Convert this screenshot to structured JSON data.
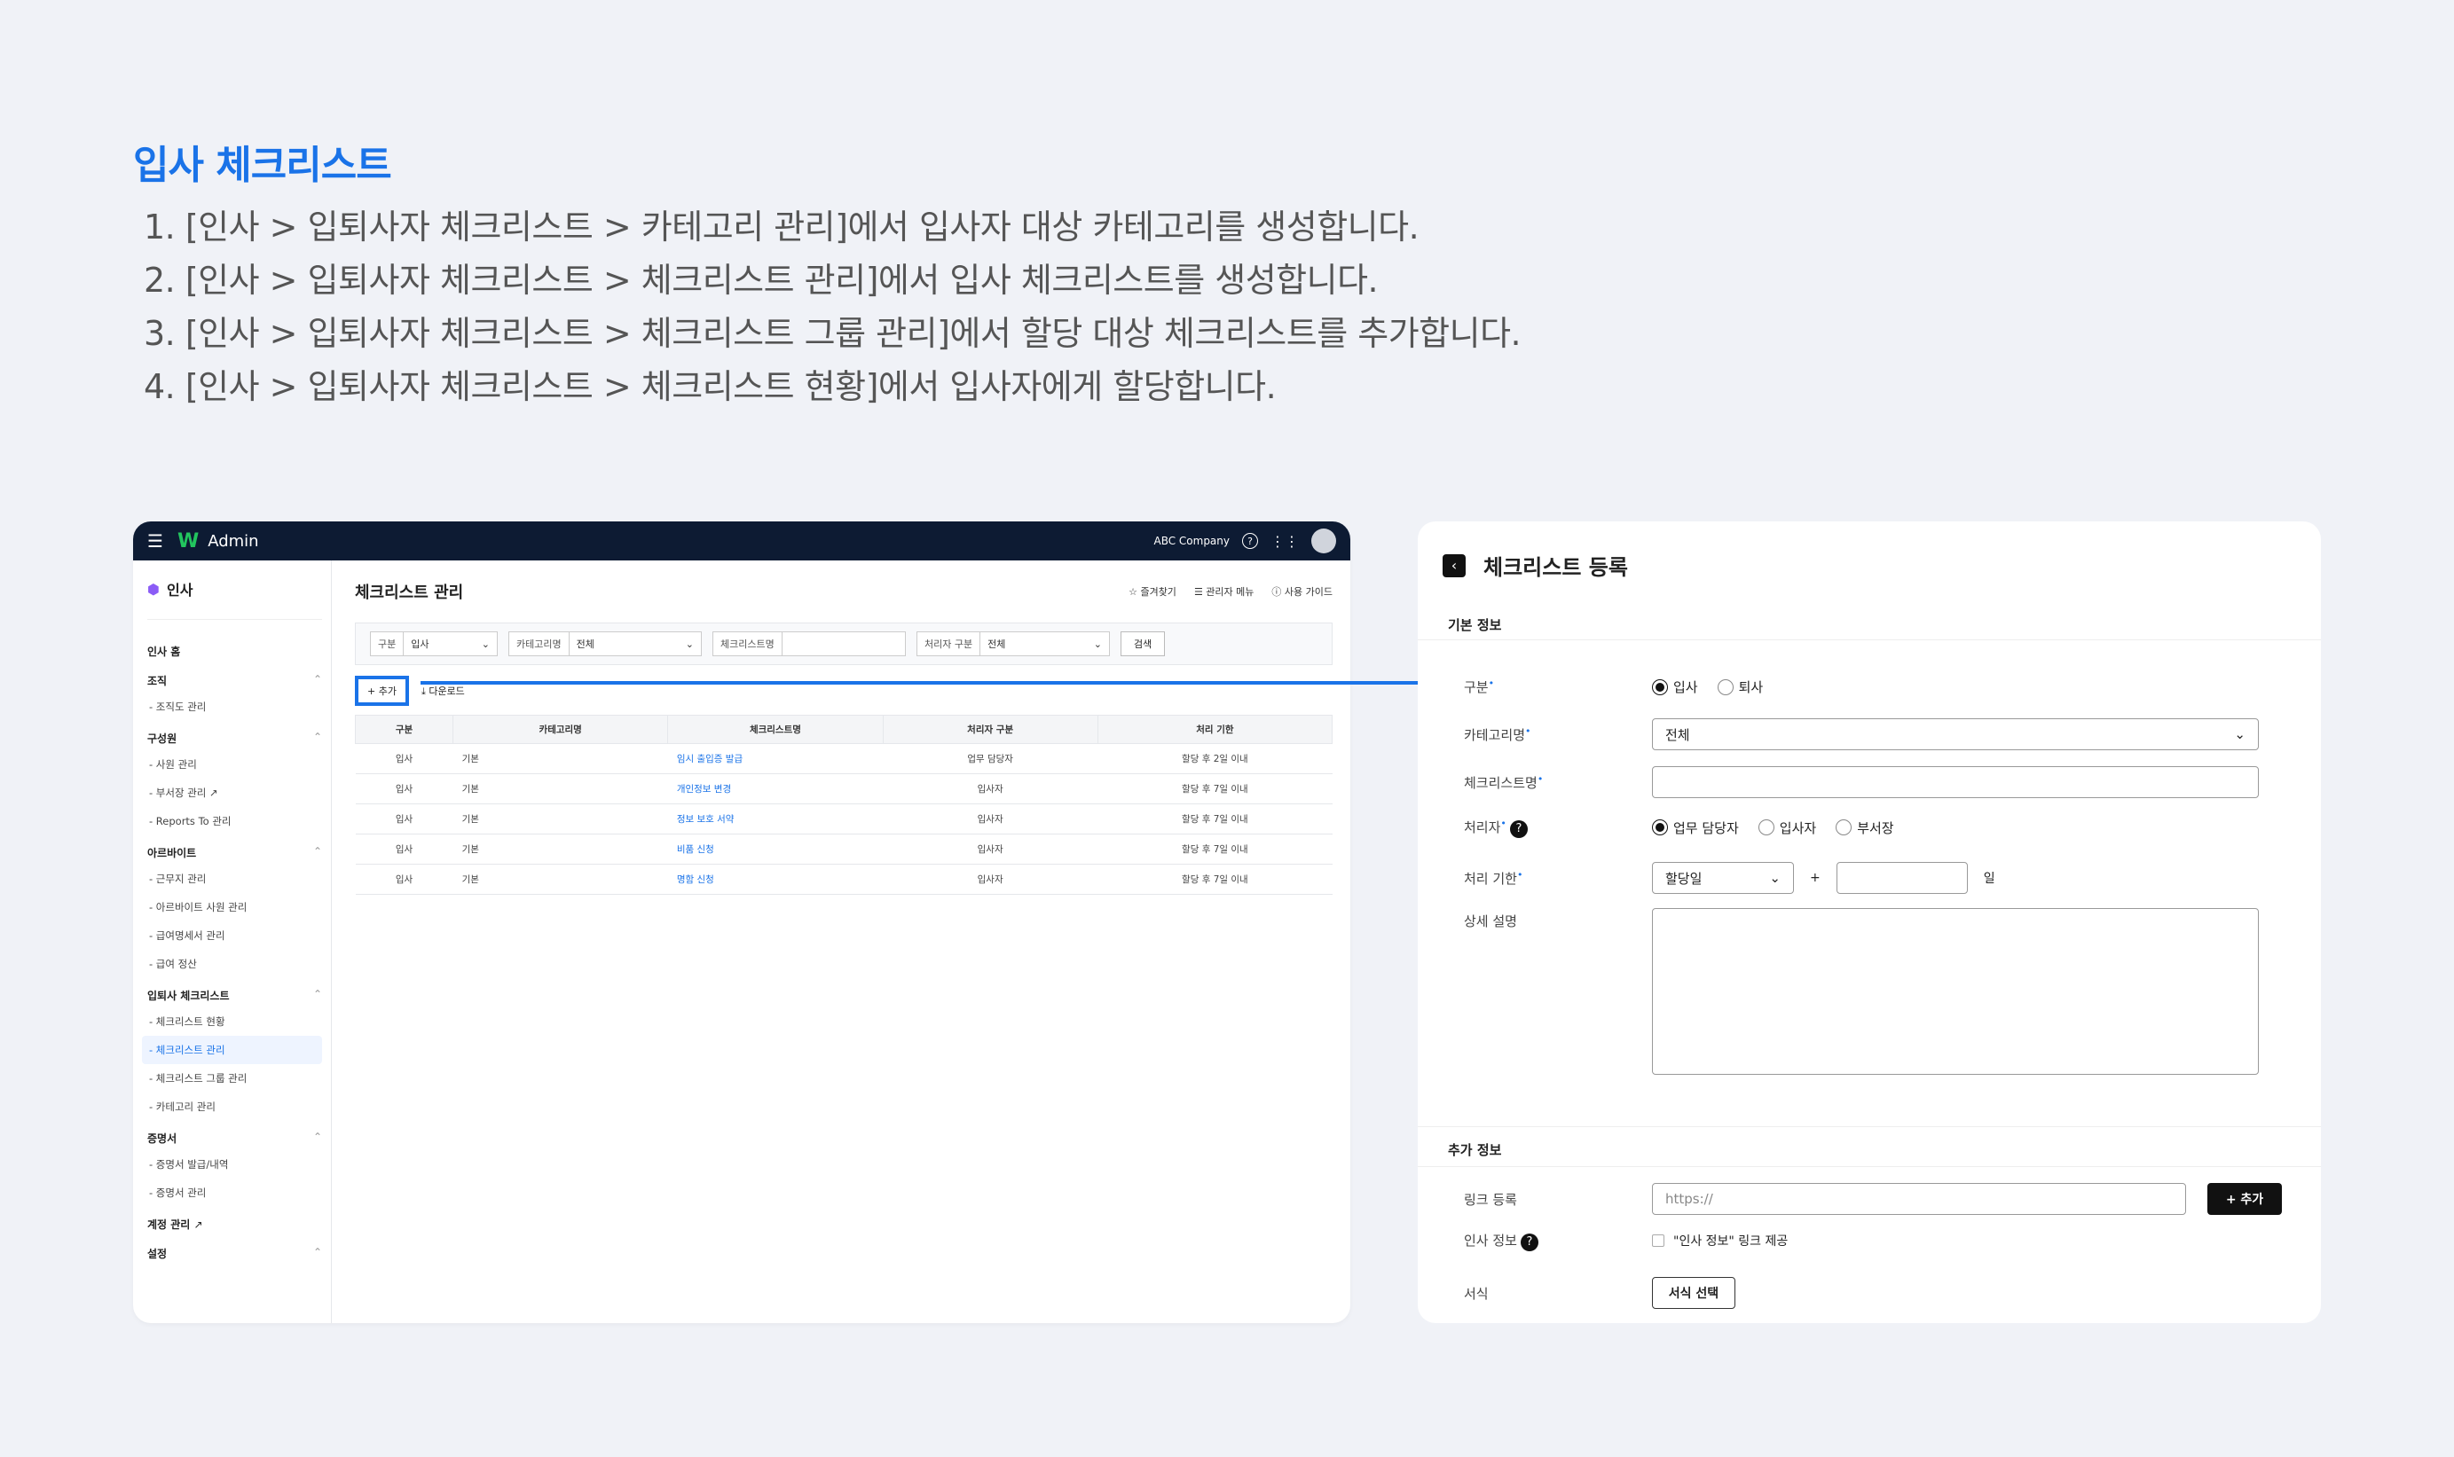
{
  "guide": {
    "title": "입사 체크리스트",
    "steps": [
      "1. [인사 > 입퇴사자 체크리스트 > 카테고리 관리]에서 입사자 대상 카테고리를 생성합니다.",
      "2. [인사 > 입퇴사자 체크리스트 > 체크리스트 관리]에서 입사 체크리스트를 생성합니다.",
      "3. [인사 > 입퇴사자 체크리스트 > 체크리스트 그룹 관리]에서 할당 대상 체크리스트를 추가합니다.",
      "4. [인사 > 입퇴사자 체크리스트 > 체크리스트 현황]에서 입사자에게 할당합니다."
    ]
  },
  "topbar": {
    "app": "Admin",
    "company": "ABC Company"
  },
  "sidebar": {
    "brand": "인사",
    "home": "인사 홈",
    "groups": [
      {
        "label": "조직",
        "items": [
          "- 조직도 관리"
        ]
      },
      {
        "label": "구성원",
        "items": [
          "- 사원 관리",
          "- 부서장 관리",
          "- Reports To 관리"
        ]
      },
      {
        "label": "아르바이트",
        "items": [
          "- 근무지 관리",
          "- 아르바이트 사원 관리",
          "- 급여명세서 관리",
          "- 급여 정산"
        ]
      },
      {
        "label": "입퇴사 체크리스트",
        "items": [
          "- 체크리스트 현황",
          "- 체크리스트 관리",
          "- 체크리스트 그룹 관리",
          "- 카테고리 관리"
        ]
      },
      {
        "label": "증명서",
        "items": [
          "- 증명서 발급/내역",
          "- 증명서 관리"
        ]
      }
    ],
    "account": "계정 관리",
    "settings": "설정"
  },
  "main": {
    "title": "체크리스트 관리",
    "links": [
      "☆ 즐겨찾기",
      "☰ 관리자 메뉴",
      "ⓘ 사용 가이드"
    ],
    "filters": {
      "type_label": "구분",
      "type_value": "입사",
      "category_label": "카테고리명",
      "category_value": "전체",
      "name_label": "체크리스트명",
      "name_value": "",
      "handler_label": "처리자 구분",
      "handler_value": "전체",
      "search": "검색"
    },
    "add": "+ 추가",
    "download": "⤓ 다운로드",
    "columns": [
      "구분",
      "카테고리명",
      "체크리스트명",
      "처리자 구분",
      "처리 기한"
    ],
    "rows": [
      [
        "입사",
        "기본",
        "임시 출입증 발급",
        "업무 담당자",
        "할당 후 2일 이내"
      ],
      [
        "입사",
        "기본",
        "개인정보 변경",
        "입사자",
        "할당 후 7일 이내"
      ],
      [
        "입사",
        "기본",
        "정보 보호 서약",
        "입사자",
        "할당 후 7일 이내"
      ],
      [
        "입사",
        "기본",
        "비품 신청",
        "입사자",
        "할당 후 7일 이내"
      ],
      [
        "입사",
        "기본",
        "명함 신청",
        "입사자",
        "할당 후 7일 이내"
      ]
    ]
  },
  "form": {
    "title": "체크리스트 등록",
    "basic_section": "기본 정보",
    "type_label": "구분",
    "type_options": [
      "입사",
      "퇴사"
    ],
    "category_label": "카테고리명",
    "category_value": "전체",
    "name_label": "체크리스트명",
    "handler_label": "처리자",
    "handler_options": [
      "업무 담당자",
      "입사자",
      "부서장"
    ],
    "deadline_label": "처리 기한",
    "deadline_value": "할당일",
    "plus": "+",
    "day_unit": "일",
    "desc_label": "상세 설명",
    "extra_section": "추가 정보",
    "link_label": "링크 등록",
    "link_placeholder": "https://",
    "link_add": "+ 추가",
    "hr_label": "인사 정보",
    "hr_check": "\"인사 정보\" 링크 제공",
    "template_label": "서식",
    "template_button": "서식 선택"
  },
  "colors": {
    "accent": "#1a73e8",
    "topbar": "#0d1b33"
  }
}
